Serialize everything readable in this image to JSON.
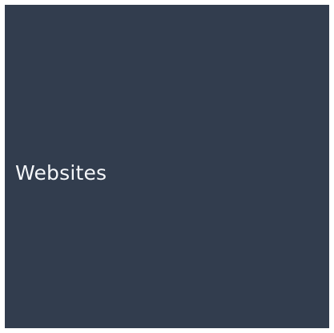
{
  "tile": {
    "label": "Websites",
    "background_color": "#323d4e",
    "text_color": "#f5f7fa"
  }
}
